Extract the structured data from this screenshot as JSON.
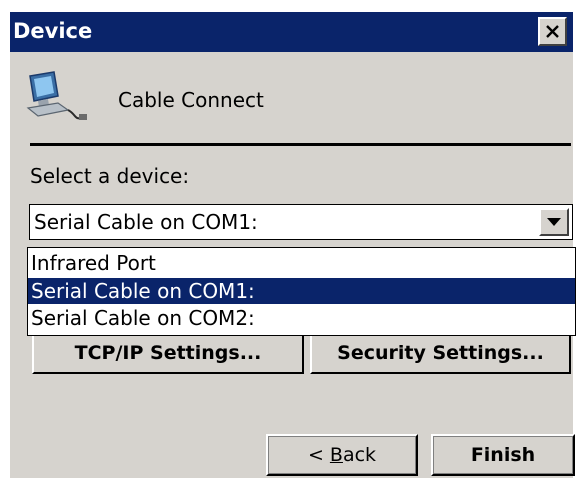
{
  "window": {
    "title": "Device",
    "close_icon": "close-icon"
  },
  "header": {
    "icon": "cable-connect-computer-icon",
    "label": "Cable Connect"
  },
  "device_select": {
    "label": "Select a device:",
    "selected_value": "Serial Cable on COM1:",
    "dropdown_icon": "chevron-down-icon",
    "options": [
      "Infrared Port",
      "Serial Cable on COM1:",
      "Serial Cable on COM2:"
    ],
    "highlighted_index": 1
  },
  "settings": {
    "tcpip_label": "TCP/IP Settings...",
    "security_label": "Security Settings..."
  },
  "footer": {
    "back_prefix": "< ",
    "back_accel": "B",
    "back_rest": "ack",
    "finish_label": "Finish"
  },
  "colors": {
    "title_bar": "#0a246a",
    "dialog_face": "#d6d3ce",
    "selection": "#0a246a"
  }
}
